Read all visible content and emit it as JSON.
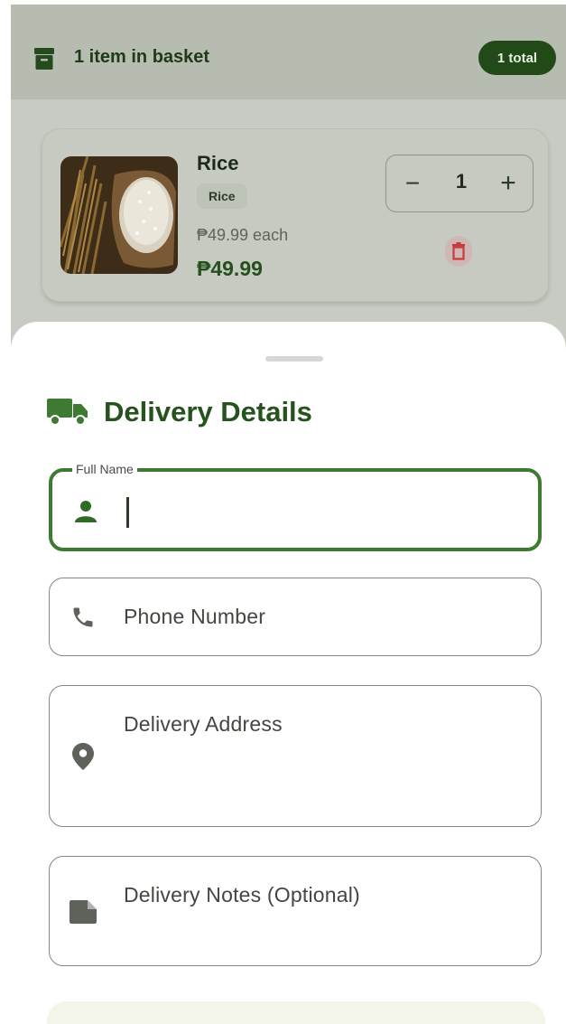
{
  "basket": {
    "title": "1 item in basket",
    "total_badge": "1 total",
    "icon": "archive-icon"
  },
  "item": {
    "name": "Rice",
    "tag": "Rice",
    "unit_price": "₱49.99 each",
    "price": "₱49.99",
    "quantity": "1",
    "minus_label": "−",
    "plus_label": "+",
    "delete_icon": "trash-icon"
  },
  "sheet": {
    "title": "Delivery Details",
    "title_icon": "truck-icon"
  },
  "form": {
    "full_name": {
      "floating_label": "Full Name",
      "value": "",
      "icon": "person-icon"
    },
    "phone": {
      "label": "Phone Number",
      "icon": "phone-icon"
    },
    "address": {
      "label": "Delivery Address",
      "icon": "location-pin-icon"
    },
    "notes": {
      "label": "Delivery Notes (Optional)",
      "icon": "note-icon"
    }
  },
  "colors": {
    "primary_green": "#3e7a31",
    "title_green": "#25521d",
    "badge_green": "#214a18",
    "delete_red": "#c83a3a",
    "field_border": "#7f8a80"
  }
}
